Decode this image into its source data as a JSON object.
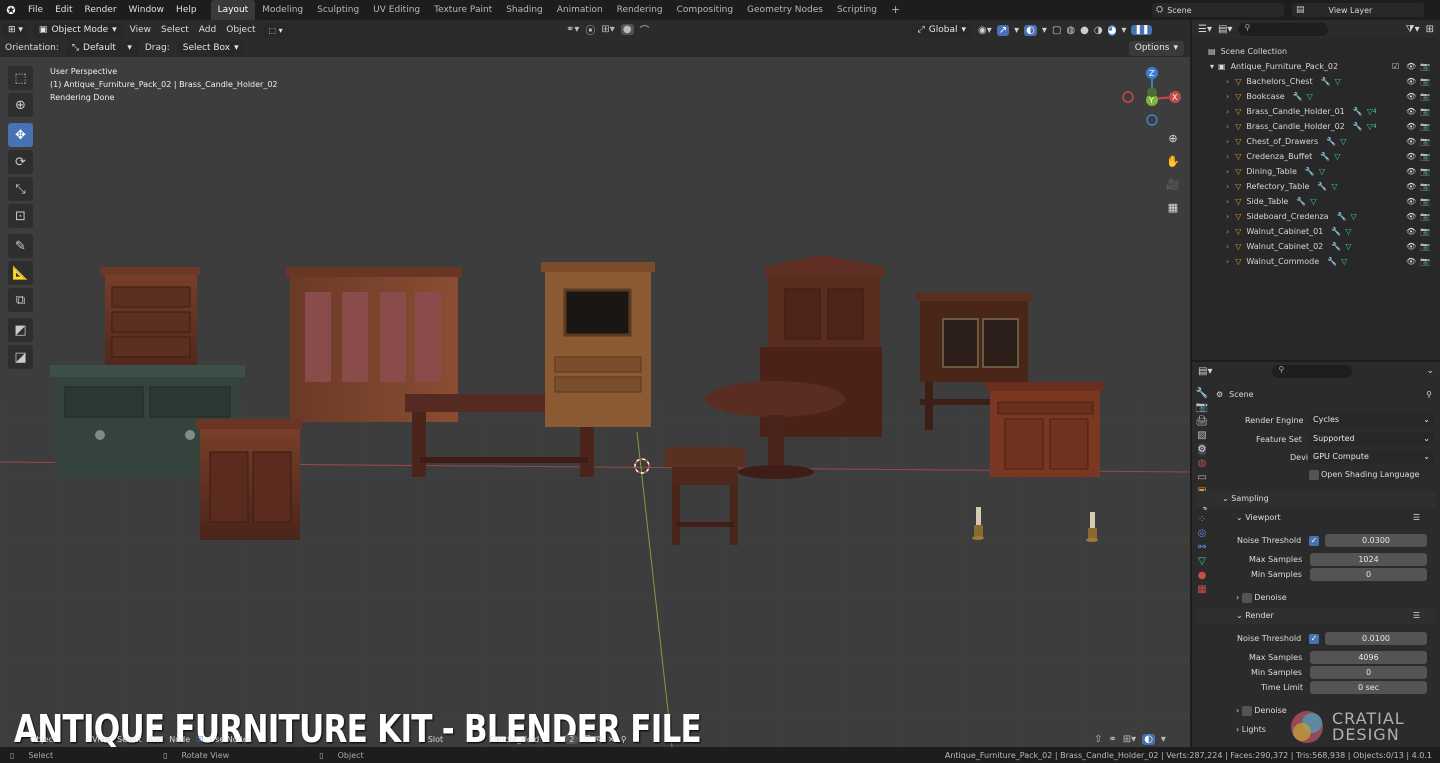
{
  "top_menu": {
    "items": [
      "File",
      "Edit",
      "Render",
      "Window",
      "Help"
    ],
    "workspace_tabs": [
      "Layout",
      "Modeling",
      "Sculpting",
      "UV Editing",
      "Texture Paint",
      "Shading",
      "Animation",
      "Rendering",
      "Compositing",
      "Geometry Nodes",
      "Scripting"
    ],
    "active_tab": "Layout",
    "plus": "+",
    "scene_field": "Scene",
    "view_layer_field": "View Layer"
  },
  "header": {
    "mode": "Object Mode",
    "menus": [
      "View",
      "Select",
      "Add",
      "Object"
    ],
    "transform_orientation": "Global",
    "options": "Options"
  },
  "tool_settings": {
    "orientation_label": "Orientation:",
    "orientation_value": "Default",
    "drag_label": "Drag:",
    "drag_value": "Select Box"
  },
  "viewport_info": {
    "line1": "User Perspective",
    "line2": "(1) Antique_Furniture_Pack_02 | Brass_Candle_Holder_02",
    "line3": "Rendering Done"
  },
  "gizmo": {
    "z": "Z",
    "y": "Y",
    "x": "X"
  },
  "watermark": {
    "title": "ANTIQUE FURNITURE KIT - BLENDER FILE",
    "brand1": "CRATIAL",
    "brand2": "DESIGN"
  },
  "bottom_bar": {
    "items": [
      "Object",
      "View",
      "Select",
      "Add",
      "Node",
      "Use Nodes",
      "Slot",
      "Candle_Hold"
    ],
    "slot_num": "2"
  },
  "footer": {
    "select": "Select",
    "rotate": "Rotate View",
    "object": "Object",
    "stats": "Antique_Furniture_Pack_02 | Brass_Candle_Holder_02 | Verts:287,224 | Faces:290,372 | Tris:568,938 | Objects:0/13 | 4.0.1"
  },
  "outliner": {
    "search_placeholder": "",
    "scene_collection": "Scene Collection",
    "pack": "Antique_Furniture_Pack_02",
    "items": [
      {
        "name": "Bachelors_Chest",
        "num": ""
      },
      {
        "name": "Bookcase",
        "num": ""
      },
      {
        "name": "Brass_Candle_Holder_01",
        "num": "4"
      },
      {
        "name": "Brass_Candle_Holder_02",
        "num": "4"
      },
      {
        "name": "Chest_of_Drawers",
        "num": ""
      },
      {
        "name": "Credenza_Buffet",
        "num": ""
      },
      {
        "name": "Dining_Table",
        "num": ""
      },
      {
        "name": "Refectory_Table",
        "num": ""
      },
      {
        "name": "Side_Table",
        "num": ""
      },
      {
        "name": "Sideboard_Credenza",
        "num": ""
      },
      {
        "name": "Walnut_Cabinet_01",
        "num": ""
      },
      {
        "name": "Walnut_Cabinet_02",
        "num": ""
      },
      {
        "name": "Walnut_Commode",
        "num": ""
      }
    ]
  },
  "properties": {
    "scene_title": "Scene",
    "render_engine_label": "Render Engine",
    "render_engine": "Cycles",
    "feature_set_label": "Feature Set",
    "feature_set": "Supported",
    "device_label": "Device",
    "device": "GPU Compute",
    "osl_label": "Open Shading Language",
    "sampling": "Sampling",
    "viewport": "Viewport",
    "vp_noise_label": "Noise Threshold",
    "vp_noise": "0.0300",
    "vp_max_label": "Max Samples",
    "vp_max": "1024",
    "vp_min_label": "Min Samples",
    "vp_min": "0",
    "denoise": "Denoise",
    "render": "Render",
    "r_noise_label": "Noise Threshold",
    "r_noise": "0.0100",
    "r_max_label": "Max Samples",
    "r_max": "4096",
    "r_min_label": "Min Samples",
    "r_min": "0",
    "time_limit_label": "Time Limit",
    "time_limit": "0 sec",
    "denoise2": "Denoise",
    "lights": "Lights"
  },
  "colors": {
    "accent": "#4772b3",
    "viewport_bg": "#3d3d3d",
    "x_axis": "#c24a4a",
    "y_axis": "#7db43a",
    "z_axis": "#3b7fd1",
    "mesh_icon": "#e8913a",
    "modifier_icon": "#6b8df0",
    "data_icon": "#33d4a0"
  }
}
